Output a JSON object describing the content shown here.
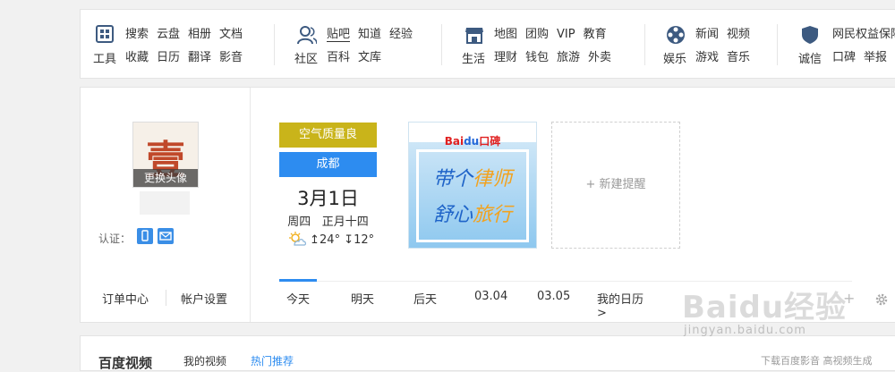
{
  "topnav": {
    "groups": [
      {
        "icon": "grid-icon",
        "label": "工具",
        "row1": [
          "搜索",
          "云盘",
          "相册",
          "文档"
        ],
        "row2": [
          "收藏",
          "日历",
          "翻译",
          "影音"
        ]
      },
      {
        "icon": "people-icon",
        "label": "社区",
        "row1": [
          "贴吧",
          "知道",
          "经验"
        ],
        "row2": [
          "百科",
          "文库"
        ]
      },
      {
        "icon": "shop-icon",
        "label": "生活",
        "row1": [
          "地图",
          "团购",
          "VIP",
          "教育"
        ],
        "row2": [
          "理财",
          "钱包",
          "旅游",
          "外卖"
        ]
      },
      {
        "icon": "film-reel-icon",
        "label": "娱乐",
        "row1": [
          "新闻",
          "视频"
        ],
        "row2": [
          "游戏",
          "音乐"
        ]
      },
      {
        "icon": "shield-icon",
        "label": "诚信",
        "row1": [
          "网民权益保障"
        ],
        "row2": [
          "口碑",
          "举报"
        ]
      }
    ]
  },
  "profile": {
    "change_avatar": "更换头像",
    "avatar_char": "壹",
    "verify_label": "认证：",
    "order_center": "订单中心",
    "account_settings": "帐户设置"
  },
  "calendar": {
    "air_quality": "空气质量良",
    "city": "成都",
    "date": "3月1日",
    "weekday": "周四",
    "lunar": "正月十四",
    "temp_high": "↥24°",
    "temp_low": "↧12°",
    "tabs": [
      "今天",
      "明天",
      "后天",
      "03.04",
      "03.05",
      "我的日历 >"
    ]
  },
  "ad": {
    "brand_a": "Bai",
    "brand_b": "du",
    "brand_c": "口碑",
    "line1a": "带个",
    "line1b": "律师",
    "line2a": "舒心",
    "line2b": "旅行"
  },
  "reminder": {
    "label": "+ 新建提醒"
  },
  "bottom": {
    "title": "百度视频",
    "tab1": "我的视频",
    "tab2": "热门推荐",
    "right": "下载百度影音 高视频生成"
  },
  "watermark": {
    "text": "Baidu经验",
    "url": "jingyan.baidu.com"
  },
  "colors": {
    "accent": "#2d8cf0",
    "air_quality": "#c9b41a"
  }
}
